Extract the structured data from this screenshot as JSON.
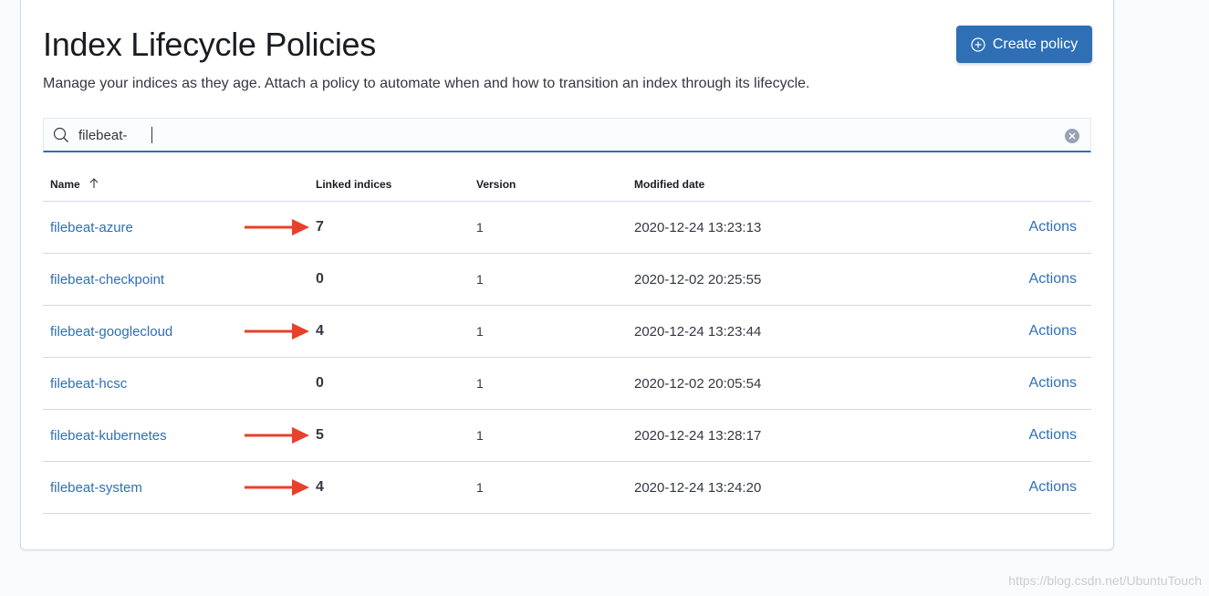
{
  "page": {
    "title": "Index Lifecycle Policies",
    "subtitle": "Manage your indices as they age. Attach a policy to automate when and how to transition an index through its lifecycle.",
    "create_button_label": "Create policy"
  },
  "search": {
    "value": "filebeat-"
  },
  "table": {
    "columns": {
      "name": "Name",
      "linked": "Linked indices",
      "version": "Version",
      "modified": "Modified date"
    },
    "rows": [
      {
        "name": "filebeat-azure",
        "linked": "7",
        "version": "1",
        "modified": "2020-12-24 13:23:13",
        "actions": "Actions",
        "arrow": true
      },
      {
        "name": "filebeat-checkpoint",
        "linked": "0",
        "version": "1",
        "modified": "2020-12-02 20:25:55",
        "actions": "Actions",
        "arrow": false
      },
      {
        "name": "filebeat-googlecloud",
        "linked": "4",
        "version": "1",
        "modified": "2020-12-24 13:23:44",
        "actions": "Actions",
        "arrow": true
      },
      {
        "name": "filebeat-hcsc",
        "linked": "0",
        "version": "1",
        "modified": "2020-12-02 20:05:54",
        "actions": "Actions",
        "arrow": false
      },
      {
        "name": "filebeat-kubernetes",
        "linked": "5",
        "version": "1",
        "modified": "2020-12-24 13:28:17",
        "actions": "Actions",
        "arrow": true
      },
      {
        "name": "filebeat-system",
        "linked": "4",
        "version": "1",
        "modified": "2020-12-24 13:24:20",
        "actions": "Actions",
        "arrow": true
      }
    ]
  },
  "watermark": "https://blog.csdn.net/UbuntuTouch",
  "colors": {
    "accent": "#2f6fb5",
    "annotation_arrow": "#e8402a"
  }
}
